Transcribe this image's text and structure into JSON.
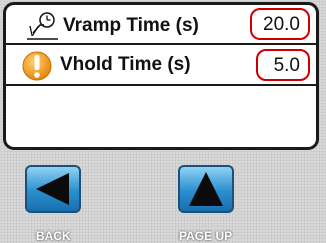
{
  "rows": [
    {
      "label": "Vramp Time (s)",
      "value": "20.0",
      "icon": "ramp-clock-icon"
    },
    {
      "label": "Vhold Time (s)",
      "value": "5.0",
      "icon": "warning-icon"
    }
  ],
  "nav": {
    "back_label": "BACK",
    "back_icon": "left-arrow-icon",
    "pageup_label": "PAGE UP",
    "pageup_icon": "up-arrow-icon"
  },
  "colors": {
    "value_border": "#cc0000",
    "warning": "#f39a1d",
    "button_blue": "#2a8fcf"
  }
}
